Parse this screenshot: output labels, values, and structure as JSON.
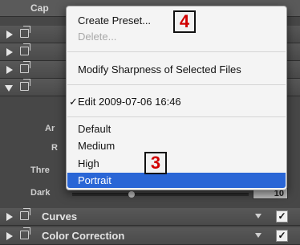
{
  "panel": {
    "header_label": "Cap",
    "partial_labels": [
      "Ar",
      "R",
      "Thre",
      "Dark"
    ],
    "value_last": "10",
    "sections": [
      {
        "title": "Curves",
        "checked": "✓"
      },
      {
        "title": "Color Correction",
        "checked": "✓"
      }
    ]
  },
  "menu": {
    "create_preset": "Create Preset...",
    "delete": "Delete...",
    "modify_sharpness": "Modify Sharpness of Selected Files",
    "checkmark": "✓",
    "edit_item": "Edit 2009-07-06 16:46",
    "presets": [
      "Default",
      "Medium",
      "High"
    ],
    "selected": "Portrait"
  },
  "annotations": {
    "badge_top": "4",
    "badge_bottom": "3"
  },
  "colors": {
    "highlight": "#2a66d6",
    "badge_text": "#d10000"
  }
}
